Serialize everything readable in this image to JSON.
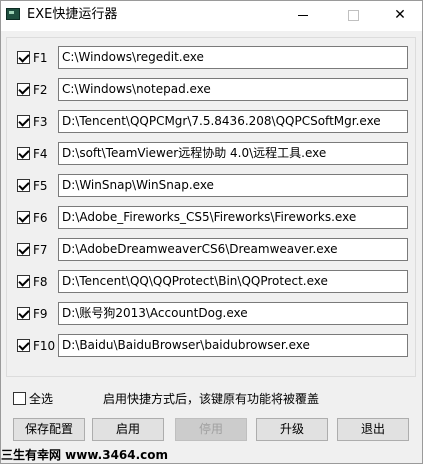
{
  "window": {
    "title": "EXE快捷运行器",
    "minimize_icon": "minimize-icon",
    "maximize_icon": "maximize-icon",
    "close_label": "✕"
  },
  "rows": [
    {
      "key": "F1",
      "checked": true,
      "path": "C:\\Windows\\regedit.exe"
    },
    {
      "key": "F2",
      "checked": true,
      "path": "C:\\Windows\\notepad.exe"
    },
    {
      "key": "F3",
      "checked": true,
      "path": "D:\\Tencent\\QQPCMgr\\7.5.8436.208\\QQPCSoftMgr.exe"
    },
    {
      "key": "F4",
      "checked": true,
      "path": "D:\\soft\\TeamViewer远程协助 4.0\\远程工具.exe"
    },
    {
      "key": "F5",
      "checked": true,
      "path": "D:\\WinSnap\\WinSnap.exe"
    },
    {
      "key": "F6",
      "checked": true,
      "path": "D:\\Adobe_Fireworks_CS5\\Fireworks\\Fireworks.exe"
    },
    {
      "key": "F7",
      "checked": true,
      "path": "D:\\AdobeDreamweaverCS6\\Dreamweaver.exe"
    },
    {
      "key": "F8",
      "checked": true,
      "path": "D:\\Tencent\\QQ\\QQProtect\\Bin\\QQProtect.exe"
    },
    {
      "key": "F9",
      "checked": true,
      "path": "D:\\账号狗2013\\AccountDog.exe"
    },
    {
      "key": "F10",
      "checked": true,
      "path": "D:\\Baidu\\BaiduBrowser\\baidubrowser.exe"
    }
  ],
  "footer": {
    "select_all_label": "全选",
    "select_all_checked": false,
    "note": "启用快捷方式后，该键原有功能将被覆盖"
  },
  "buttons": {
    "save": "保存配置",
    "enable": "启用",
    "disable": "停用",
    "upgrade": "升级",
    "exit": "退出"
  },
  "watermark": "三生有幸网 www.3464.com"
}
